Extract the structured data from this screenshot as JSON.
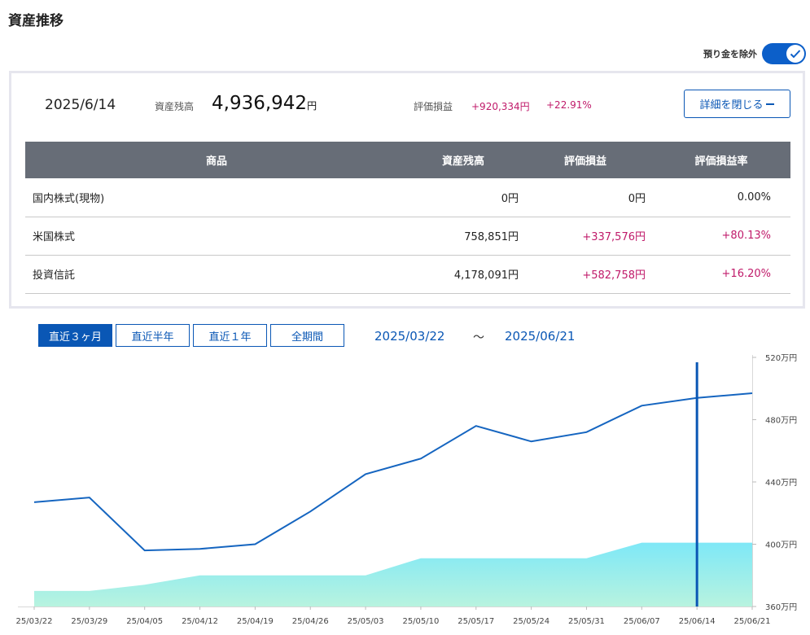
{
  "page": {
    "title": "資産推移"
  },
  "toggle": {
    "label": "預り金を除外",
    "on": true
  },
  "summary": {
    "date": "2025/6/14",
    "balance_label": "資産残高",
    "balance_value": "4,936,942",
    "balance_unit": "円",
    "pl_label": "評価損益",
    "pl_amount": "+920,334円",
    "pl_percent": "+22.91%",
    "close_button": "詳細を閉じる"
  },
  "holdings": {
    "headers": [
      "商品",
      "資産残高",
      "評価損益",
      "評価損益率"
    ],
    "rows": [
      {
        "name": "国内株式(現物)",
        "balance": "0円",
        "pl": "0円",
        "pl_rate": "0.00%",
        "positive": false
      },
      {
        "name": "米国株式",
        "balance": "758,851円",
        "pl": "+337,576円",
        "pl_rate": "+80.13%",
        "positive": true
      },
      {
        "name": "投資信託",
        "balance": "4,178,091円",
        "pl": "+582,758円",
        "pl_rate": "+16.20%",
        "positive": true
      }
    ]
  },
  "range": {
    "buttons": [
      "直近３ヶ月",
      "直近半年",
      "直近１年",
      "全期間"
    ],
    "active_index": 0,
    "from": "2025/03/22",
    "separator": "～",
    "to": "2025/06/21"
  },
  "colors": {
    "accent": "#0a57b5",
    "positive": "#c01a6a",
    "line": "#1565c0",
    "area_top": "#7ee8f7",
    "area_bottom": "#b8f3df"
  },
  "chart_data": {
    "type": "line",
    "x": [
      "25/03/22",
      "25/03/29",
      "25/04/05",
      "25/04/12",
      "25/04/19",
      "25/04/26",
      "25/05/03",
      "25/05/10",
      "25/05/17",
      "25/05/24",
      "25/05/31",
      "25/06/07",
      "25/06/14",
      "25/06/21"
    ],
    "series": [
      {
        "kind": "line",
        "values": [
          427,
          430,
          396,
          397,
          400,
          421,
          445,
          455,
          476,
          466,
          472,
          489,
          494,
          497
        ]
      },
      {
        "kind": "area",
        "values": [
          370,
          370,
          374,
          380,
          380,
          380,
          380,
          391,
          391,
          391,
          391,
          401,
          401,
          401
        ]
      }
    ],
    "y_ticks": [
      "520万円",
      "480万円",
      "440万円",
      "400万円",
      "360万円"
    ],
    "y_tick_values": [
      520,
      480,
      440,
      400,
      360
    ],
    "ylim": [
      360,
      520
    ],
    "y_unit": "万円",
    "selected_x": "25/06/14",
    "grid": false
  }
}
